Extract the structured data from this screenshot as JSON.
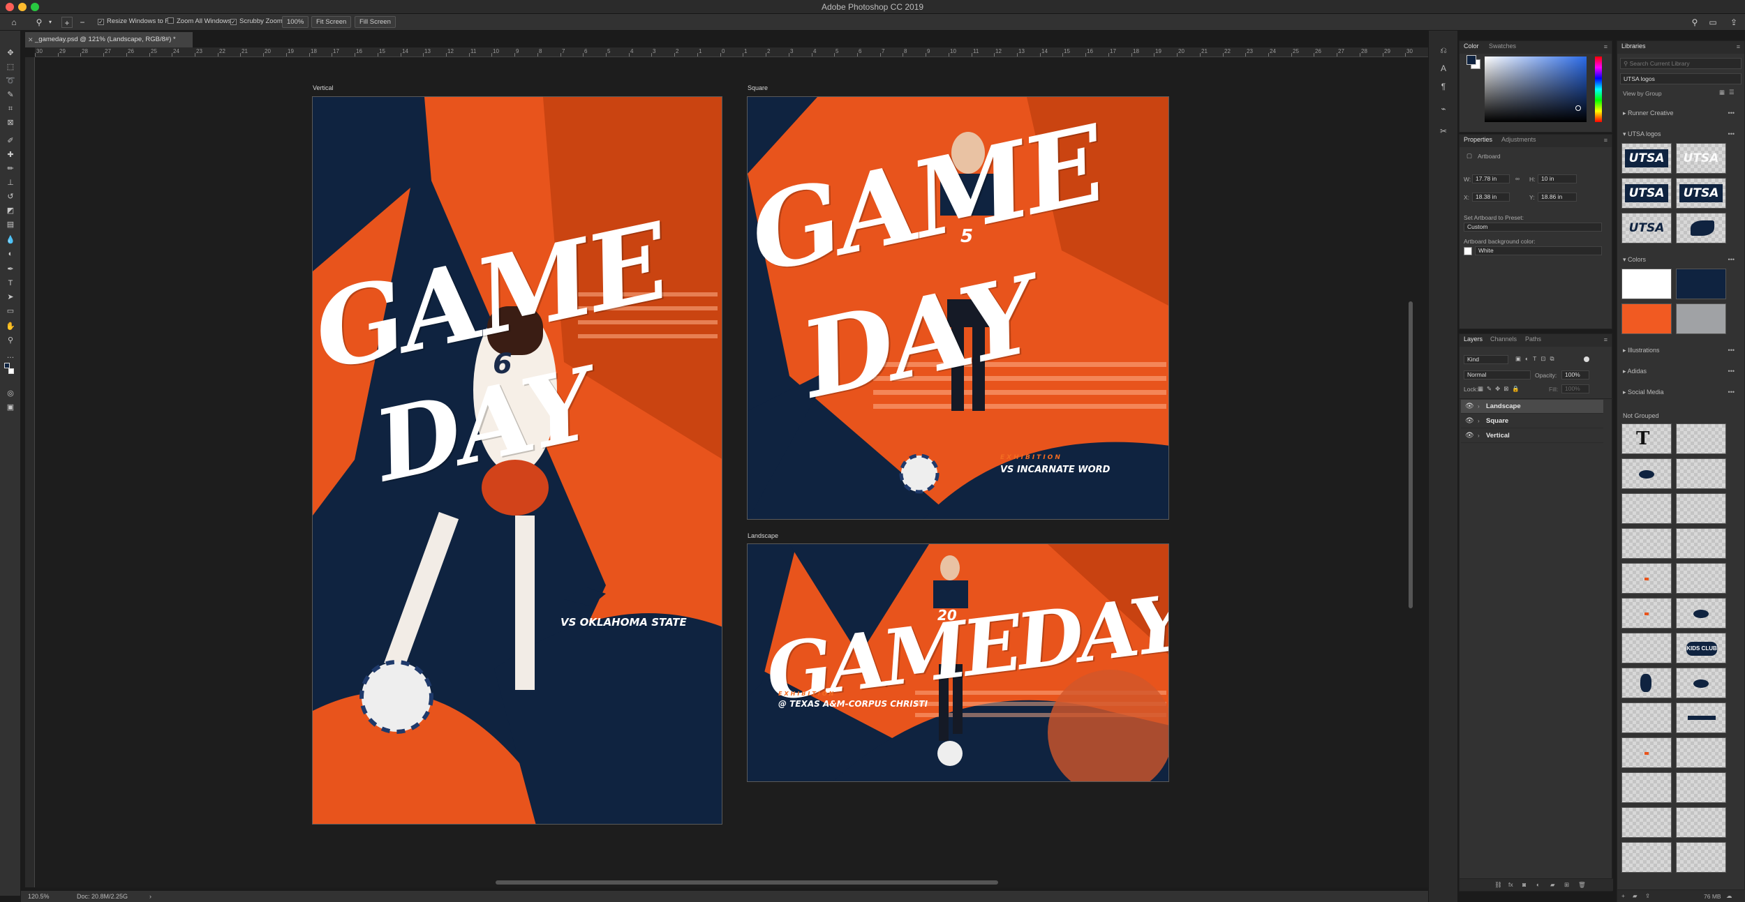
{
  "window": {
    "title": "Adobe Photoshop CC 2019"
  },
  "options_bar": {
    "resize_windows": "Resize Windows to Fit",
    "zoom_all": "Zoom All Windows",
    "scrubby_zoom": "Scrubby Zoom",
    "zoom_value": "100%",
    "fit_screen": "Fit Screen",
    "fill_screen": "Fill Screen"
  },
  "document_tab": {
    "title": "_gameday.psd @ 121% (Landscape, RGB/8#) *"
  },
  "rulers": {
    "top_ticks": [
      "30",
      "29",
      "28",
      "27",
      "26",
      "25",
      "24",
      "23",
      "22",
      "21",
      "20",
      "19",
      "18",
      "17",
      "16",
      "15",
      "14",
      "13",
      "12",
      "11",
      "10",
      "9",
      "8",
      "7",
      "6",
      "5",
      "4",
      "3",
      "2",
      "1",
      "0",
      "1",
      "2",
      "3",
      "4",
      "5",
      "6",
      "7",
      "8",
      "9",
      "10",
      "11",
      "12",
      "13",
      "14",
      "15",
      "16",
      "17",
      "18",
      "19",
      "20",
      "21",
      "22",
      "23",
      "24",
      "25",
      "26",
      "27",
      "28",
      "29",
      "30"
    ]
  },
  "artboards": {
    "vertical": {
      "label": "Vertical",
      "title_line1": "GAME",
      "title_line2": "DAY",
      "jersey_number": "6",
      "opponent": "VS OKLAHOMA STATE"
    },
    "square": {
      "label": "Square",
      "title_line1": "GAME",
      "title_line2": "DAY",
      "jersey_number": "5",
      "exhibition": "EXHIBITION",
      "opponent": "VS INCARNATE WORD"
    },
    "landscape": {
      "label": "Landscape",
      "title": "GAMEDAY",
      "jersey_number": "20",
      "exhibition": "EXHIBITION",
      "opponent": "@ TEXAS A&M-CORPUS CHRISTI"
    }
  },
  "status_bar": {
    "zoom": "120.5%",
    "doc": "Doc: 20.8M/2.25G"
  },
  "color_panel": {
    "tabs": [
      "Color",
      "Swatches"
    ],
    "fg_color": "#0f2340",
    "bg_color": "#ffffff"
  },
  "properties_panel": {
    "tabs": [
      "Properties",
      "Adjustments"
    ],
    "type": "Artboard",
    "w_label": "W:",
    "w_value": "17.78 in",
    "h_label": "H:",
    "h_value": "10 in",
    "x_label": "X:",
    "x_value": "18.38 in",
    "y_label": "Y:",
    "y_value": "18.86 in",
    "preset_label": "Set Artboard to Preset:",
    "preset_value": "Custom",
    "bg_label": "Artboard background color:",
    "bg_value": "White"
  },
  "layers_panel": {
    "tabs": [
      "Layers",
      "Channels",
      "Paths"
    ],
    "filter": "Kind",
    "blend_mode": "Normal",
    "opacity_label": "Opacity:",
    "opacity": "100%",
    "lock_label": "Lock:",
    "fill_label": "Fill:",
    "fill": "100%",
    "layers": [
      {
        "name": "Landscape",
        "selected": true
      },
      {
        "name": "Square",
        "selected": false
      },
      {
        "name": "Vertical",
        "selected": false
      }
    ],
    "fx": "fx"
  },
  "libraries_panel": {
    "tab": "Libraries",
    "search_placeholder": "Search Current Library",
    "library_name": "UTSA logos",
    "view_by": "View by Group",
    "groups": [
      "Runner Creative",
      "UTSA logos",
      "Colors",
      "Illustrations",
      "Adidas",
      "Social Media"
    ],
    "not_grouped": "Not Grouped",
    "logo_text": "UTSA",
    "swatches": [
      "#ffffff",
      "#0f2340",
      "#f15a22",
      "#a0a2a5"
    ],
    "kids_club": "KIDS CLUB",
    "size": "76 MB"
  },
  "colors": {
    "navy": "#0f2340",
    "orange": "#f15a22",
    "orange_dark": "#c2400f"
  }
}
